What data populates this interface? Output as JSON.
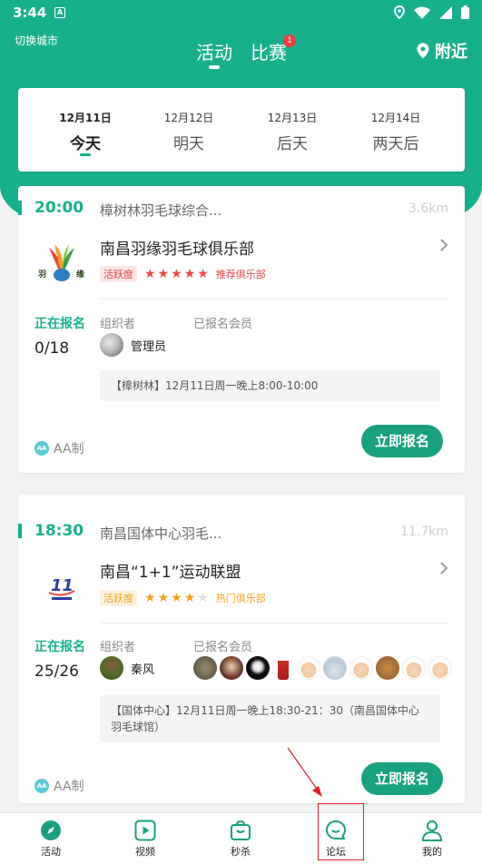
{
  "status_bar": {
    "time": "3:44",
    "notif_icon": "A"
  },
  "header": {
    "city_switch": "切换城市",
    "tabs": [
      {
        "label": "活动"
      },
      {
        "label": "比赛"
      }
    ],
    "match_badge": "1",
    "nearby": "附近"
  },
  "dates": [
    {
      "date": "12月11日",
      "day": "今天"
    },
    {
      "date": "12月12日",
      "day": "明天"
    },
    {
      "date": "12月13日",
      "day": "后天"
    },
    {
      "date": "12月14日",
      "day": "两天后"
    }
  ],
  "activities": [
    {
      "time": "20:00",
      "venue": "樟树林羽毛球综合...",
      "distance": "3.6km",
      "club": "南昌羽缘羽毛球俱乐部",
      "activity_tag": "活跃度",
      "stars": 5,
      "recommend": "推荐俱乐部",
      "status": "正在报名",
      "count": "0/18",
      "organizer_label": "组织者",
      "organizer": "管理员",
      "members_label": "已报名会员",
      "note": "【樟树林】12月11日周一晚上8:00-10:00",
      "payment": "AA制",
      "button": "立即报名"
    },
    {
      "time": "18:30",
      "venue": "南昌国体中心羽毛...",
      "distance": "11.7km",
      "club": "南昌“1+1”运动联盟",
      "activity_tag": "活跃度",
      "stars": 4,
      "recommend": "热门俱乐部",
      "status": "正在报名",
      "count": "25/26",
      "organizer_label": "组织者",
      "organizer": "秦风",
      "members_label": "已报名会员",
      "note": "【国体中心】12月11日周一晚上18:30-21：30（南昌国体中心羽毛球馆）",
      "payment": "AA制",
      "button": "立即报名"
    }
  ],
  "bottom_nav": [
    {
      "label": "活动",
      "icon": "compass-icon"
    },
    {
      "label": "视频",
      "icon": "play-icon"
    },
    {
      "label": "秒杀",
      "icon": "shopping-bag-icon"
    },
    {
      "label": "论坛",
      "icon": "chat-bubble-icon"
    },
    {
      "label": "我的",
      "icon": "person-icon"
    }
  ],
  "colors": {
    "primary": "#18b08c",
    "button": "#18a07f",
    "highlight": "#e0202a"
  }
}
